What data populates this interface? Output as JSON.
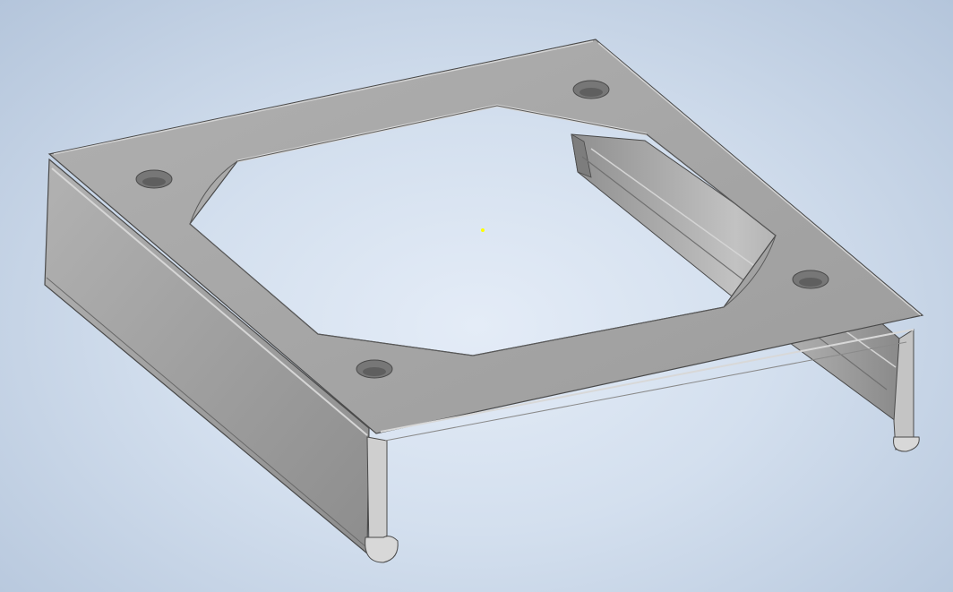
{
  "viewport": {
    "background_center": "#e4ecf7",
    "background_edge": "#b4c5db"
  },
  "model": {
    "part": "fan-mount-bracket",
    "mounting_holes": 4,
    "colors": {
      "top_face": "#a3a3a3",
      "side_face": "#969696",
      "edge_line": "#4a4a4a",
      "highlight": "#d6d6d6",
      "hole": "#6f6f6f"
    }
  },
  "origin_marker": {
    "color": "#ffff00"
  }
}
